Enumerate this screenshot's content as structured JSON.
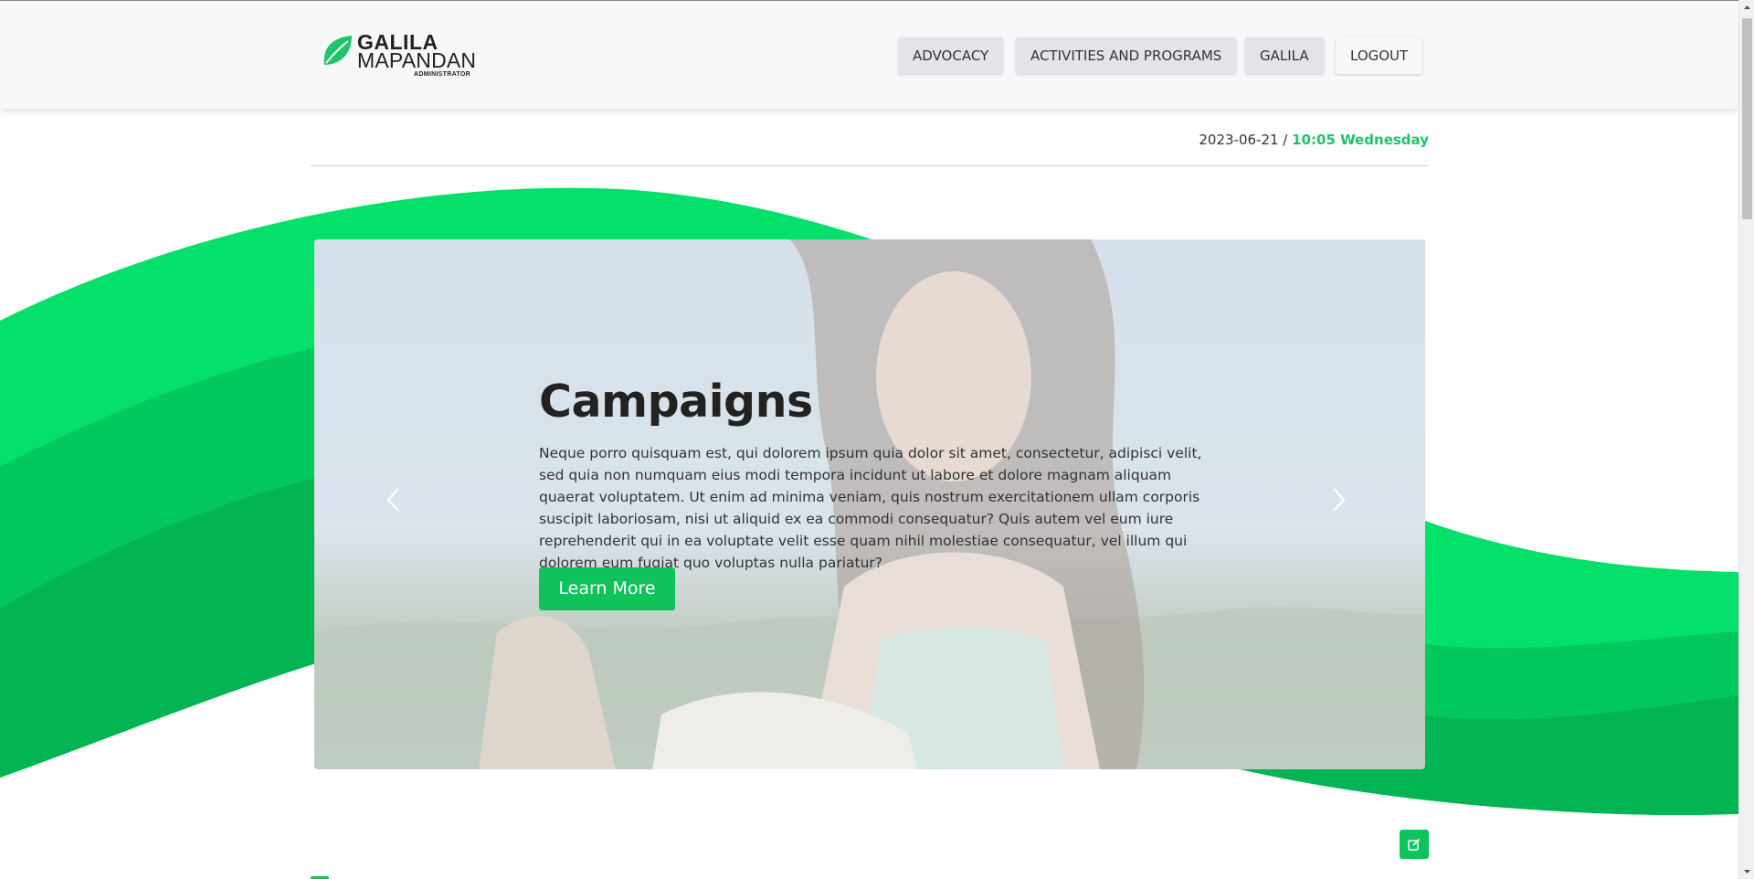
{
  "brand": {
    "line1": "GALILA",
    "line2": "MAPANDAN",
    "line3": "ADMINISTRATOR",
    "color": "#1ec46a"
  },
  "nav": {
    "items": [
      {
        "label": "ADVOCACY"
      },
      {
        "label": "ACTIVITIES AND PROGRAMS"
      },
      {
        "label": "GALILA"
      },
      {
        "label": "LOGOUT"
      }
    ]
  },
  "datetime": {
    "date": "2023-06-21 /",
    "time": "10:05 Wednesday"
  },
  "carousel": {
    "title": "Campaigns",
    "body": "Neque porro quisquam est, qui dolorem ipsum quia dolor sit amet, consectetur, adipisci velit, sed quia non numquam eius modi tempora incidunt ut labore et dolore magnam aliquam quaerat voluptatem. Ut enim ad minima veniam, quis nostrum exercitationem ullam corporis suscipit laboriosam, nisi ut aliquid ex ea commodi consequatur? Quis autem vel eum iure reprehenderit qui in ea voluptate velit esse quam nihil molestiae consequatur, vel illum qui dolorem eum fugiat quo voluptas nulla pariatur?",
    "cta": "Learn More",
    "prev_icon": "chevron-left-icon",
    "next_icon": "chevron-right-icon"
  },
  "actions": {
    "edit_icon": "edit-icon"
  },
  "colors": {
    "accent": "#0fc25a",
    "wave_light": "#05e06a",
    "wave_mid": "#03c85d",
    "wave_dark": "#02b452"
  }
}
